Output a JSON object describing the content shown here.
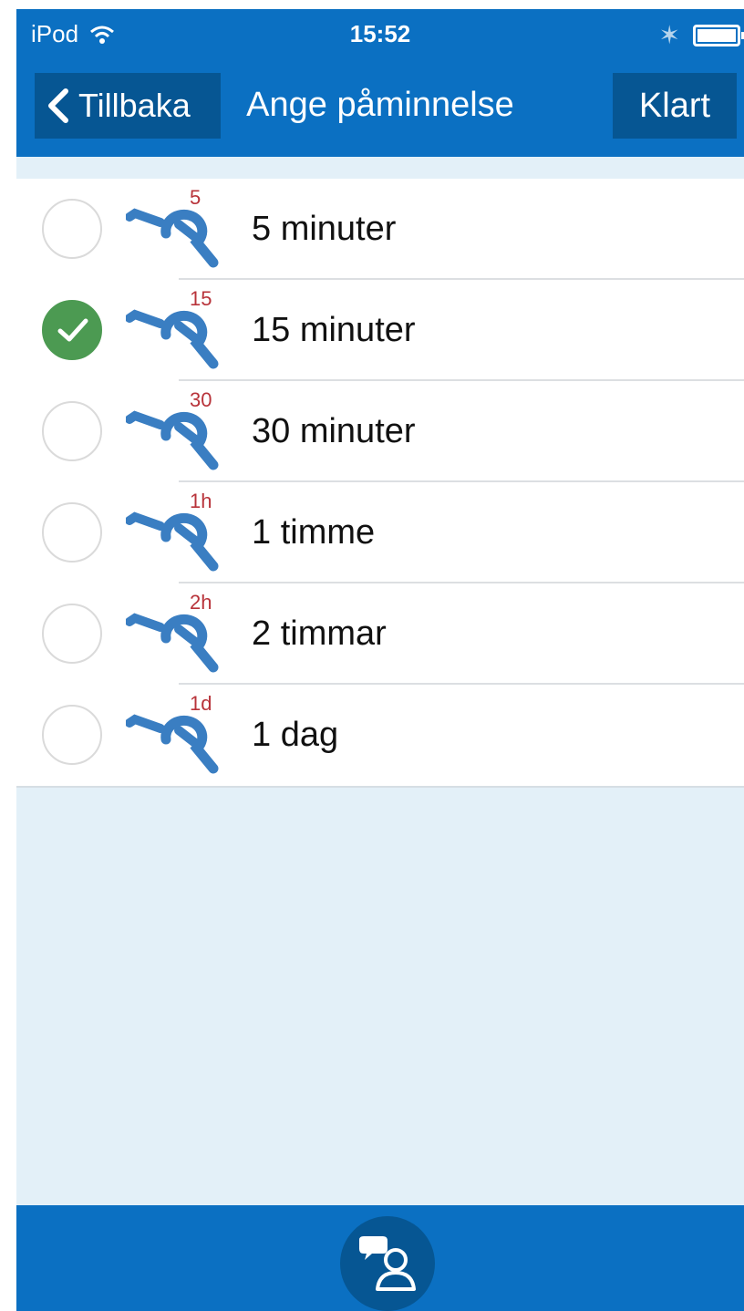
{
  "status_bar": {
    "carrier": "iPod",
    "time": "15:52",
    "wifi_icon": "wifi-icon",
    "bluetooth_icon": "bluetooth-icon",
    "battery_icon": "battery-icon"
  },
  "nav": {
    "back_label": "Tillbaka",
    "title": "Ange påminnelse",
    "done_label": "Klart"
  },
  "options": [
    {
      "badge": "5",
      "label": "5 minuter",
      "selected": false
    },
    {
      "badge": "15",
      "label": "15 minuter",
      "selected": true
    },
    {
      "badge": "30",
      "label": "30 minuter",
      "selected": false
    },
    {
      "badge": "1h",
      "label": "1 timme",
      "selected": false
    },
    {
      "badge": "2h",
      "label": "2 timmar",
      "selected": false
    },
    {
      "badge": "1d",
      "label": "1 dag",
      "selected": false
    }
  ],
  "tab_bar": {
    "icon": "contacts-chat-icon"
  },
  "colors": {
    "brand_blue": "#0b70c2",
    "dark_blue": "#065693",
    "check_green": "#4c9a52",
    "badge_red": "#b8333a",
    "knot_blue": "#3a7ec2",
    "background": "#e3f0f8"
  }
}
